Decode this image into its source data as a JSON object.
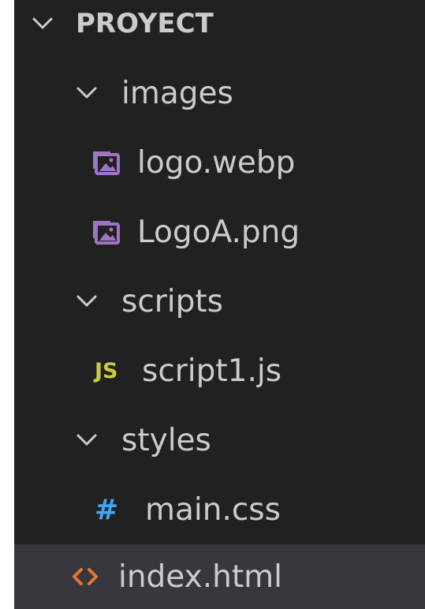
{
  "explorer": {
    "root": {
      "label": "PROYECT",
      "expanded": true,
      "icon": "chevron-down-icon"
    },
    "folders": {
      "images": {
        "label": "images",
        "expanded": true,
        "icon": "chevron-down-icon"
      },
      "scripts": {
        "label": "scripts",
        "expanded": true,
        "icon": "chevron-down-icon"
      },
      "styles": {
        "label": "styles",
        "expanded": true,
        "icon": "chevron-down-icon"
      }
    },
    "files": {
      "logo_webp": {
        "label": "logo.webp",
        "icon": "image-file-icon"
      },
      "logoa_png": {
        "label": "LogoA.png",
        "icon": "image-file-icon"
      },
      "script1_js": {
        "label": "script1.js",
        "icon_text": "JS",
        "icon": "js-file-icon"
      },
      "main_css": {
        "label": "main.css",
        "icon_text": "#",
        "icon": "css-file-icon"
      },
      "index_html": {
        "label": "index.html",
        "icon": "html-file-icon",
        "selected": true
      }
    }
  },
  "colors": {
    "background": "#212121",
    "text": "#cccccc",
    "selected_row": "#37373d",
    "image_icon": "#a074c4",
    "js_icon": "#cbcb41",
    "css_icon": "#42a5f5",
    "html_icon": "#e37933"
  }
}
